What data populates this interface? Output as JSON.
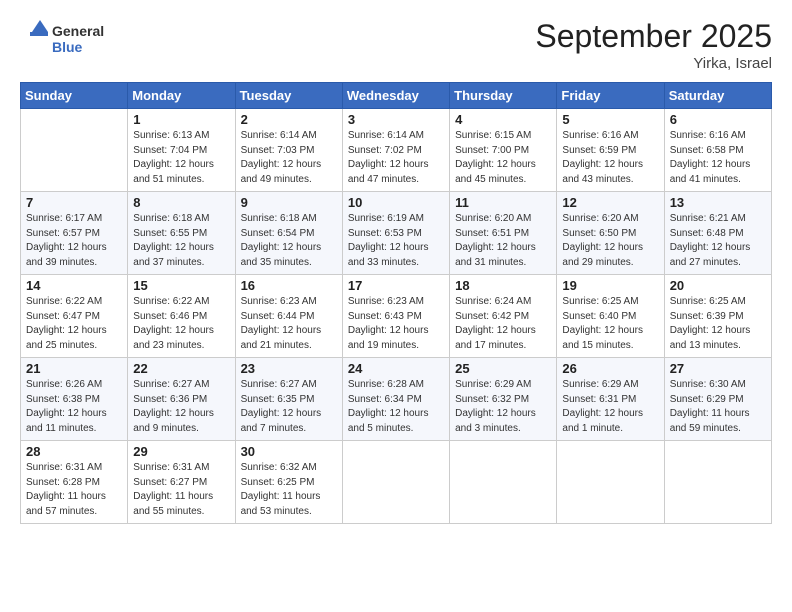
{
  "header": {
    "logo_general": "General",
    "logo_blue": "Blue",
    "month_title": "September 2025",
    "location": "Yirka, Israel"
  },
  "days_of_week": [
    "Sunday",
    "Monday",
    "Tuesday",
    "Wednesday",
    "Thursday",
    "Friday",
    "Saturday"
  ],
  "weeks": [
    [
      {
        "day": "",
        "info": ""
      },
      {
        "day": "1",
        "info": "Sunrise: 6:13 AM\nSunset: 7:04 PM\nDaylight: 12 hours\nand 51 minutes."
      },
      {
        "day": "2",
        "info": "Sunrise: 6:14 AM\nSunset: 7:03 PM\nDaylight: 12 hours\nand 49 minutes."
      },
      {
        "day": "3",
        "info": "Sunrise: 6:14 AM\nSunset: 7:02 PM\nDaylight: 12 hours\nand 47 minutes."
      },
      {
        "day": "4",
        "info": "Sunrise: 6:15 AM\nSunset: 7:00 PM\nDaylight: 12 hours\nand 45 minutes."
      },
      {
        "day": "5",
        "info": "Sunrise: 6:16 AM\nSunset: 6:59 PM\nDaylight: 12 hours\nand 43 minutes."
      },
      {
        "day": "6",
        "info": "Sunrise: 6:16 AM\nSunset: 6:58 PM\nDaylight: 12 hours\nand 41 minutes."
      }
    ],
    [
      {
        "day": "7",
        "info": "Sunrise: 6:17 AM\nSunset: 6:57 PM\nDaylight: 12 hours\nand 39 minutes."
      },
      {
        "day": "8",
        "info": "Sunrise: 6:18 AM\nSunset: 6:55 PM\nDaylight: 12 hours\nand 37 minutes."
      },
      {
        "day": "9",
        "info": "Sunrise: 6:18 AM\nSunset: 6:54 PM\nDaylight: 12 hours\nand 35 minutes."
      },
      {
        "day": "10",
        "info": "Sunrise: 6:19 AM\nSunset: 6:53 PM\nDaylight: 12 hours\nand 33 minutes."
      },
      {
        "day": "11",
        "info": "Sunrise: 6:20 AM\nSunset: 6:51 PM\nDaylight: 12 hours\nand 31 minutes."
      },
      {
        "day": "12",
        "info": "Sunrise: 6:20 AM\nSunset: 6:50 PM\nDaylight: 12 hours\nand 29 minutes."
      },
      {
        "day": "13",
        "info": "Sunrise: 6:21 AM\nSunset: 6:48 PM\nDaylight: 12 hours\nand 27 minutes."
      }
    ],
    [
      {
        "day": "14",
        "info": "Sunrise: 6:22 AM\nSunset: 6:47 PM\nDaylight: 12 hours\nand 25 minutes."
      },
      {
        "day": "15",
        "info": "Sunrise: 6:22 AM\nSunset: 6:46 PM\nDaylight: 12 hours\nand 23 minutes."
      },
      {
        "day": "16",
        "info": "Sunrise: 6:23 AM\nSunset: 6:44 PM\nDaylight: 12 hours\nand 21 minutes."
      },
      {
        "day": "17",
        "info": "Sunrise: 6:23 AM\nSunset: 6:43 PM\nDaylight: 12 hours\nand 19 minutes."
      },
      {
        "day": "18",
        "info": "Sunrise: 6:24 AM\nSunset: 6:42 PM\nDaylight: 12 hours\nand 17 minutes."
      },
      {
        "day": "19",
        "info": "Sunrise: 6:25 AM\nSunset: 6:40 PM\nDaylight: 12 hours\nand 15 minutes."
      },
      {
        "day": "20",
        "info": "Sunrise: 6:25 AM\nSunset: 6:39 PM\nDaylight: 12 hours\nand 13 minutes."
      }
    ],
    [
      {
        "day": "21",
        "info": "Sunrise: 6:26 AM\nSunset: 6:38 PM\nDaylight: 12 hours\nand 11 minutes."
      },
      {
        "day": "22",
        "info": "Sunrise: 6:27 AM\nSunset: 6:36 PM\nDaylight: 12 hours\nand 9 minutes."
      },
      {
        "day": "23",
        "info": "Sunrise: 6:27 AM\nSunset: 6:35 PM\nDaylight: 12 hours\nand 7 minutes."
      },
      {
        "day": "24",
        "info": "Sunrise: 6:28 AM\nSunset: 6:34 PM\nDaylight: 12 hours\nand 5 minutes."
      },
      {
        "day": "25",
        "info": "Sunrise: 6:29 AM\nSunset: 6:32 PM\nDaylight: 12 hours\nand 3 minutes."
      },
      {
        "day": "26",
        "info": "Sunrise: 6:29 AM\nSunset: 6:31 PM\nDaylight: 12 hours\nand 1 minute."
      },
      {
        "day": "27",
        "info": "Sunrise: 6:30 AM\nSunset: 6:29 PM\nDaylight: 11 hours\nand 59 minutes."
      }
    ],
    [
      {
        "day": "28",
        "info": "Sunrise: 6:31 AM\nSunset: 6:28 PM\nDaylight: 11 hours\nand 57 minutes."
      },
      {
        "day": "29",
        "info": "Sunrise: 6:31 AM\nSunset: 6:27 PM\nDaylight: 11 hours\nand 55 minutes."
      },
      {
        "day": "30",
        "info": "Sunrise: 6:32 AM\nSunset: 6:25 PM\nDaylight: 11 hours\nand 53 minutes."
      },
      {
        "day": "",
        "info": ""
      },
      {
        "day": "",
        "info": ""
      },
      {
        "day": "",
        "info": ""
      },
      {
        "day": "",
        "info": ""
      }
    ]
  ]
}
